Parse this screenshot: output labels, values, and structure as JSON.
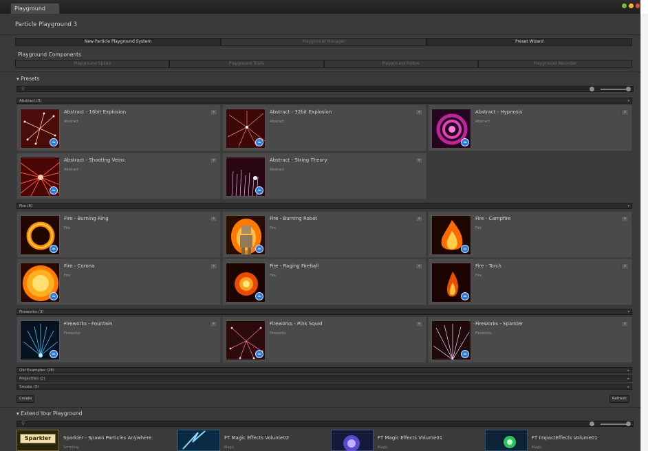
{
  "window": {
    "tab_label": "Playground",
    "title": "Particle Playground 3",
    "traffic_lights": [
      "#6fbf3a",
      "#f2b233",
      "#e8463c"
    ]
  },
  "toolbar": {
    "buttons": [
      {
        "label": "New Particle Playground System",
        "enabled": true
      },
      {
        "label": "Playground Manager",
        "enabled": false
      },
      {
        "label": "Preset Wizard",
        "enabled": true
      }
    ]
  },
  "components": {
    "header": "Playground Components",
    "buttons": [
      "Playground Spline",
      "Playground Trails",
      "Playground Follow",
      "Playground Recorder"
    ]
  },
  "presets": {
    "header": "Presets",
    "search_placeholder": "",
    "categories": [
      {
        "label": "Abstract (5)",
        "items": [
          {
            "name": "Abstract - 16bit Explosion",
            "category": "Abstract",
            "icon": "abstract-explosion-16bit"
          },
          {
            "name": "Abstract - 32bit Explosion",
            "category": "Abstract",
            "icon": "abstract-explosion-32bit"
          },
          {
            "name": "Abstract - Hypnosis",
            "category": "Abstract",
            "icon": "abstract-hypnosis"
          },
          {
            "name": "Abstract - Shooting Veins",
            "category": "Abstract",
            "icon": "abstract-shooting-veins"
          },
          {
            "name": "Abstract - String Theory",
            "category": "Abstract",
            "icon": "abstract-string-theory"
          }
        ]
      },
      {
        "label": "Fire (6)",
        "items": [
          {
            "name": "Fire - Burning Ring",
            "category": "Fire",
            "icon": "fire-ring"
          },
          {
            "name": "Fire - Burning Robot",
            "category": "Fire",
            "icon": "fire-robot"
          },
          {
            "name": "Fire - Campfire",
            "category": "Fire",
            "icon": "fire-campfire"
          },
          {
            "name": "Fire - Corona",
            "category": "Fire",
            "icon": "fire-corona"
          },
          {
            "name": "Fire - Raging Fireball",
            "category": "Fire",
            "icon": "fire-fireball"
          },
          {
            "name": "Fire - Torch",
            "category": "Fire",
            "icon": "fire-torch"
          }
        ]
      },
      {
        "label": "Fireworks (3)",
        "items": [
          {
            "name": "Fireworks - Fountain",
            "category": "Fireworks",
            "icon": "fireworks-fountain"
          },
          {
            "name": "Fireworks - Pink Squid",
            "category": "Fireworks",
            "icon": "fireworks-pink-squid"
          },
          {
            "name": "Fireworks - Sparkler",
            "category": "Fireworks",
            "icon": "fireworks-sparkler"
          }
        ]
      }
    ],
    "collapsed": [
      "Old Examples (28)",
      "Projectiles (2)",
      "Smoke (3)"
    ],
    "create_label": "Create",
    "refresh_label": "Refresh"
  },
  "extend": {
    "header": "Extend Your Playground",
    "search_placeholder": "",
    "items": [
      {
        "name": "Sparkler - Spawn Particles Anywhere",
        "category": "Scripting",
        "thumb_text": "Sparkler",
        "icon": "sparkler-logo"
      },
      {
        "name": "FT Magic Effects Volume02",
        "category": "Magic",
        "icon": "magic-effects-02"
      },
      {
        "name": "FT Magic Effects Volume01",
        "category": "Magic",
        "icon": "magic-effects-01"
      },
      {
        "name": "FT ImpactEffects Volume01",
        "category": "Magic",
        "icon": "impact-effects-01"
      }
    ]
  },
  "colors": {
    "panel": "#3a3a3a",
    "card": "#4a4a4a",
    "badge": "#2e7bd6"
  }
}
